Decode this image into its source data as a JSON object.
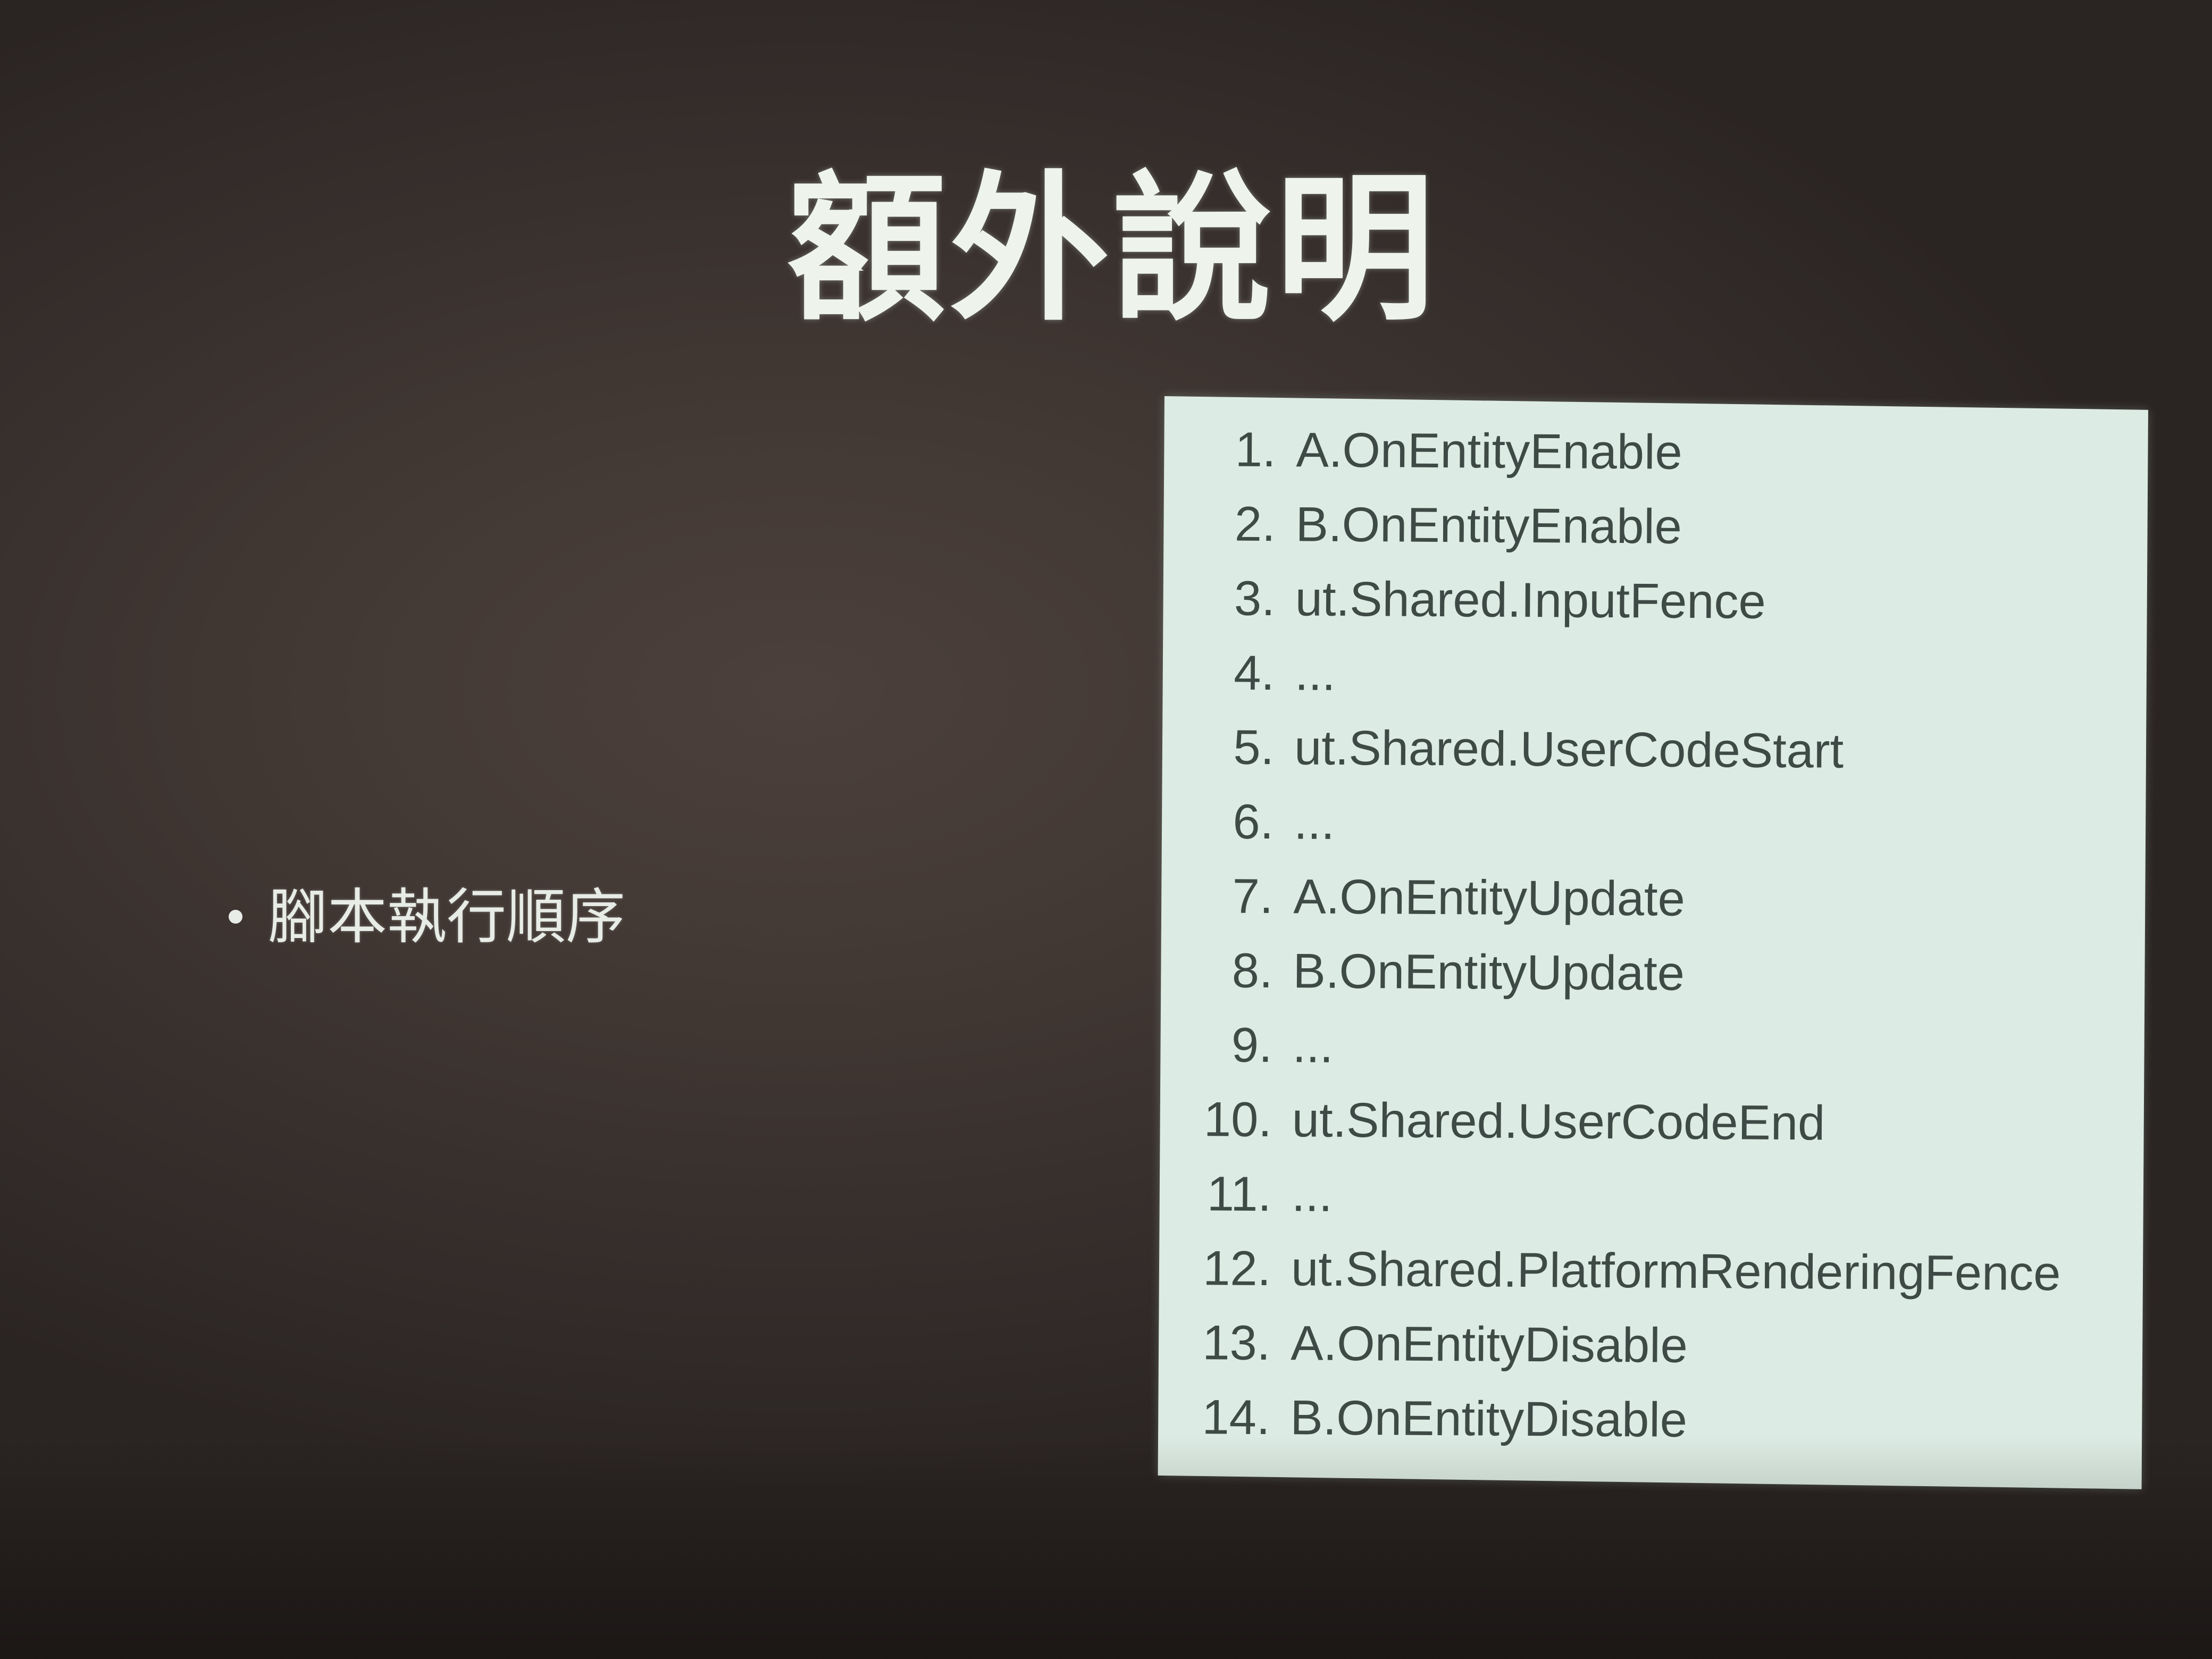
{
  "slide": {
    "title": "額外說明",
    "bullet": "腳本執行順序",
    "execution_order": [
      {
        "number": "1.",
        "text": "A.OnEntityEnable"
      },
      {
        "number": "2.",
        "text": "B.OnEntityEnable"
      },
      {
        "number": "3.",
        "text": "ut.Shared.InputFence"
      },
      {
        "number": "4.",
        "text": "..."
      },
      {
        "number": "5.",
        "text": "ut.Shared.UserCodeStart"
      },
      {
        "number": "6.",
        "text": "..."
      },
      {
        "number": "7.",
        "text": "A.OnEntityUpdate"
      },
      {
        "number": "8.",
        "text": "B.OnEntityUpdate"
      },
      {
        "number": "9.",
        "text": "..."
      },
      {
        "number": "10.",
        "text": "ut.Shared.UserCodeEnd"
      },
      {
        "number": "11.",
        "text": "..."
      },
      {
        "number": "12.",
        "text": "ut.Shared.PlatformRenderingFence"
      },
      {
        "number": "13.",
        "text": "A.OnEntityDisable"
      },
      {
        "number": "14.",
        "text": "B.OnEntityDisable"
      }
    ]
  },
  "colors": {
    "background": "#3f3632",
    "title_text": "#eef4ec",
    "box_background": "#dcebe3",
    "box_text": "#3e4a46"
  }
}
